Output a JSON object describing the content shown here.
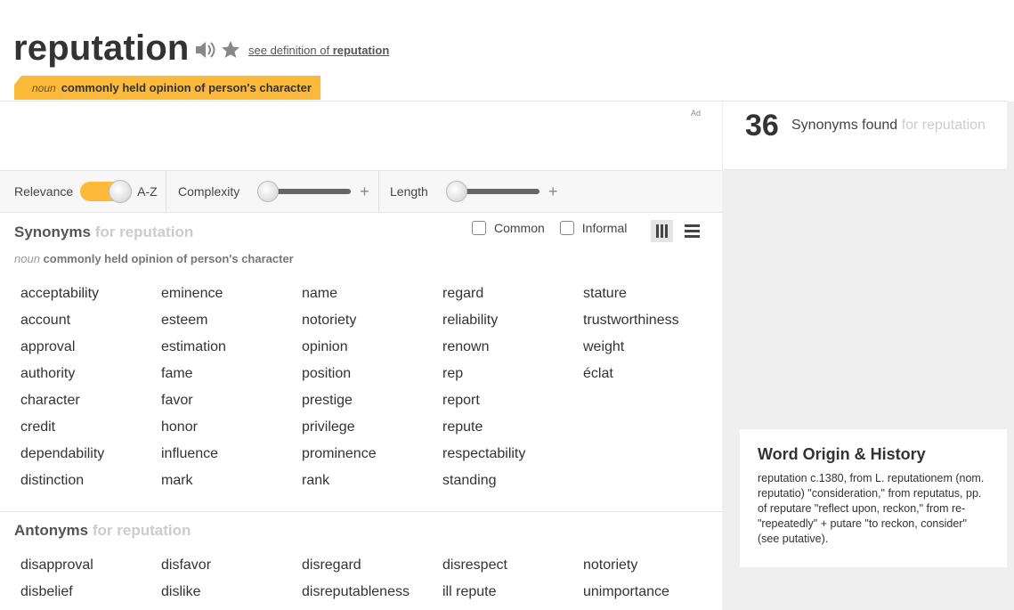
{
  "header": {
    "word": "reputation",
    "see_definition_prefix": "see definition of",
    "see_definition_word": "reputation",
    "sense_pos": "noun",
    "sense_def": "commonly held opinion of person's character",
    "accent_color": "#fcb93a"
  },
  "ad": {
    "label": "Ad"
  },
  "count": {
    "number": "36",
    "text": "Synonyms found",
    "for_text": "for reputation"
  },
  "filters": {
    "relevance_label": "Relevance",
    "az_label": "A-Z",
    "complexity_label": "Complexity",
    "length_label": "Length",
    "plus_glyph": "+"
  },
  "synonyms": {
    "title": "Synonyms",
    "for_text": "for reputation",
    "sense_pos": "noun",
    "sense_def": "commonly held opinion of person's character",
    "common_label": "Common",
    "informal_label": "Informal",
    "words": [
      "acceptability",
      "account",
      "approval",
      "authority",
      "character",
      "credit",
      "dependability",
      "distinction",
      "eminence",
      "esteem",
      "estimation",
      "fame",
      "favor",
      "honor",
      "influence",
      "mark",
      "name",
      "notoriety",
      "opinion",
      "position",
      "prestige",
      "privilege",
      "prominence",
      "rank",
      "regard",
      "reliability",
      "renown",
      "rep",
      "report",
      "repute",
      "respectability",
      "standing",
      "stature",
      "trustworthiness",
      "weight",
      "éclat"
    ]
  },
  "antonyms": {
    "title": "Antonyms",
    "for_text": "for reputation",
    "words": [
      "disapproval",
      "disbelief",
      "disfavor",
      "dislike",
      "disregard",
      "disreputableness",
      "disrespect",
      "ill repute",
      "notoriety",
      "unimportance"
    ]
  },
  "origin": {
    "title": "Word Origin & History",
    "text": "reputation c.1380, from L. reputationem (nom. reputatio) \"consideration,\" from reputatus, pp. of reputare \"reflect upon, reckon,\" from re- \"repeatedly\" + putare \"to reckon, consider\" (see putative)."
  }
}
